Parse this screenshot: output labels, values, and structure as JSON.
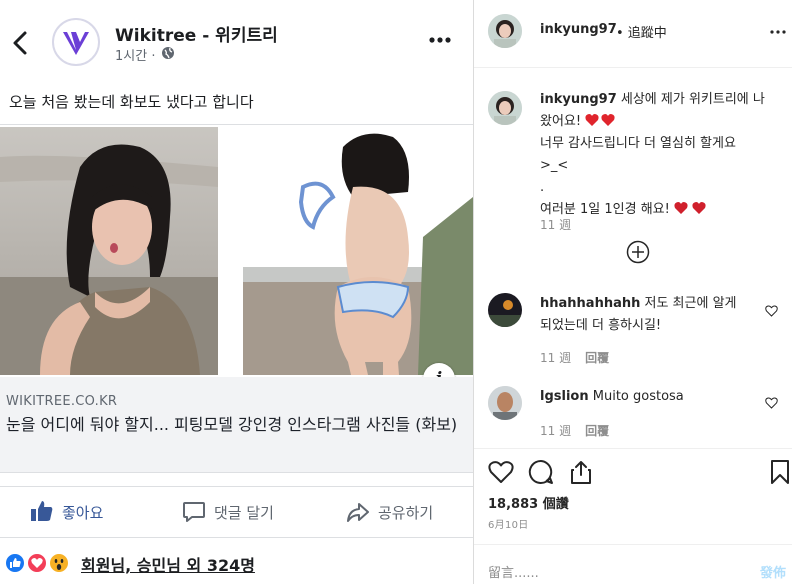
{
  "facebook": {
    "page_name": "Wikitree - 위키트리",
    "post_time": "1시간 ·",
    "post_text": "오늘 처음 봤는데 화보도 냈다고 합니다",
    "link": {
      "domain": "WIKITREE.CO.KR",
      "title": "눈을 어디에 둬야 할지... 피팅모델 강인경 인스타그램 사진들 (화보)"
    },
    "actions": {
      "like": "좋아요",
      "comment": "댓글 달기",
      "share": "공유하기"
    },
    "reactions_text": "회원님, 승민님 외 324명",
    "info_label": "i"
  },
  "instagram": {
    "username": "inkyung97",
    "follow_status": "• 追蹤中",
    "caption": {
      "user": "inkyung97",
      "lines": [
        "세상에 제가 위키트리에 나",
        "왔어요!",
        "너무 감사드립니다 더 열심히 할게요",
        ">_<",
        ".",
        "여러분 1일 1인경 해요!"
      ],
      "time": "11 週"
    },
    "comments": [
      {
        "user": "hhahhahhahh",
        "text_line1": "저도 최근에 알게",
        "text_line2": "되었는데 더 흥하시길!",
        "time": "11 週",
        "reply": "回覆"
      },
      {
        "user": "lgslion",
        "text_line1": "Muito gostosa",
        "text_line2": "",
        "time": "11 週",
        "reply": "回覆"
      }
    ],
    "likes": "18,883 個讚",
    "date": "6月10日",
    "comment_placeholder": "留言......",
    "post_button": "發佈"
  },
  "colors": {
    "fb_blue": "#385898",
    "heart_red": "#ed4956",
    "ig_text": "#262626",
    "ig_meta": "#8e8e8e"
  }
}
